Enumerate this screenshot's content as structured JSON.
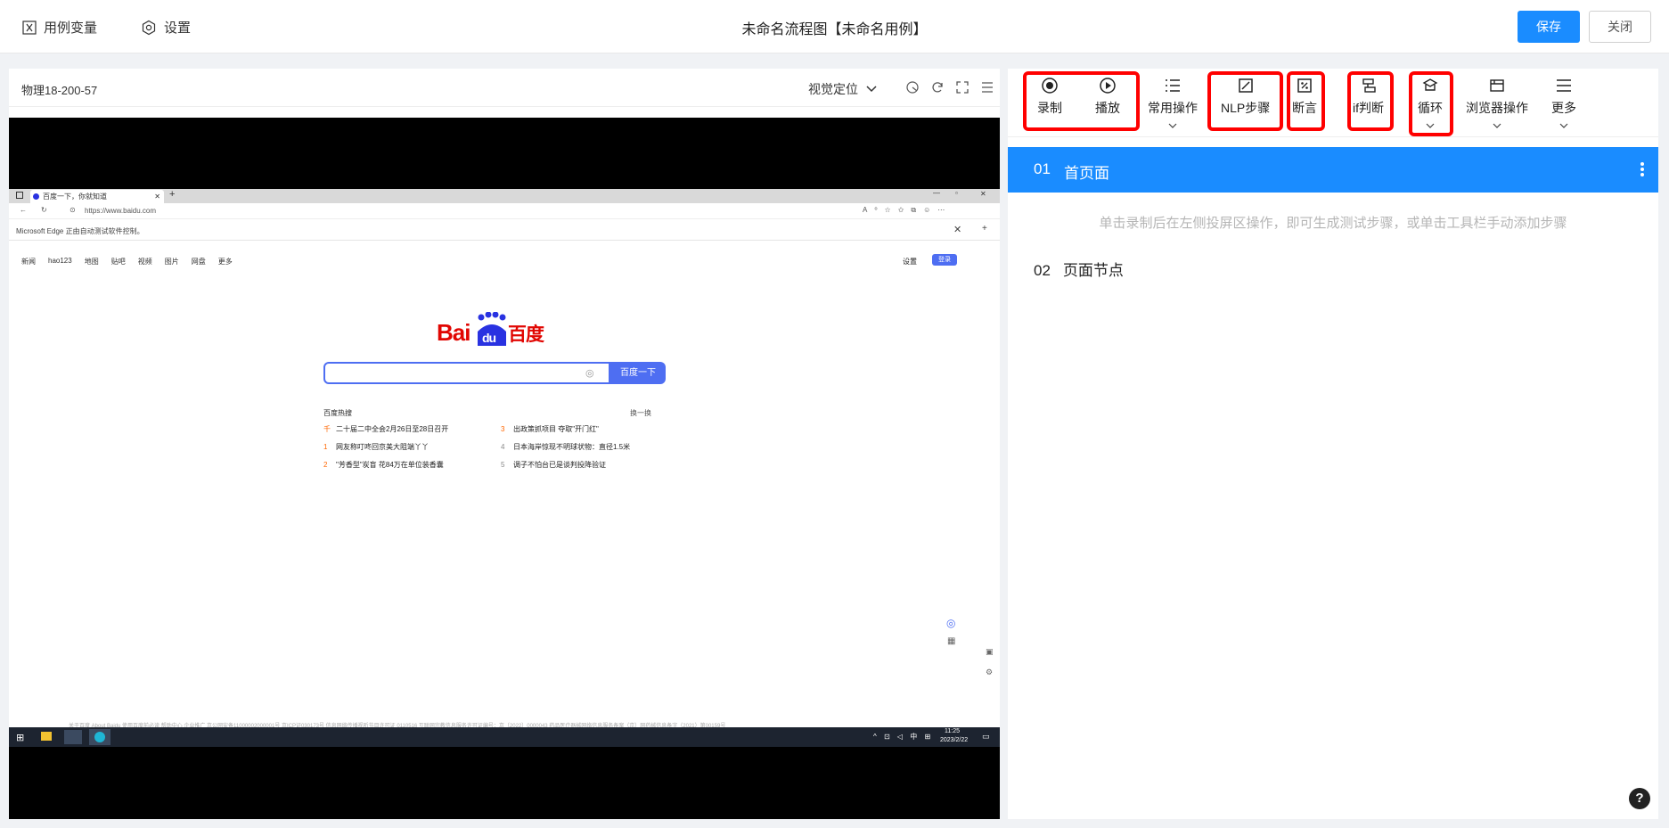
{
  "header": {
    "variables_label": "用例变量",
    "settings_label": "设置",
    "title": "未命名流程图【未命名用例】",
    "save_label": "保存",
    "close_label": "关闭"
  },
  "left_panel": {
    "device_name": "物理18-200-57",
    "visual_locate_label": "视觉定位"
  },
  "browser": {
    "tab_title": "百度一下，你就知道",
    "url": "https://www.baidu.com",
    "automation_notice": "Microsoft Edge 正由自动测试软件控制。",
    "nav_links": [
      "新闻",
      "hao123",
      "地图",
      "贴吧",
      "视频",
      "图片",
      "网盘",
      "更多"
    ],
    "settings_link": "设置",
    "login_button": "登录",
    "logo_text": "Bai度百度",
    "search_button": "百度一下",
    "hot_title": "百度热搜",
    "hot_refresh": "换一换",
    "hot_items": [
      {
        "num": "千",
        "text": "二十届二中全会2月26日至28日召开"
      },
      {
        "num": "1",
        "text": "网友称叮咚回京美大阻端丫丫"
      },
      {
        "num": "2",
        "text": "\"芳香型\"炭盲 花84万在单位装香囊"
      },
      {
        "num": "3",
        "text": "出政策抓项目 夺取\"开门红\""
      },
      {
        "num": "4",
        "text": "日本海岸惊现不明球状物：直径1.5米"
      },
      {
        "num": "5",
        "text": "调子不怕台已是谈判投降验证"
      }
    ],
    "footer_text": "关于百度   About Baidu   使用百度前必读   帮助中心   企业推广   京公网安备11000002000001号   京ICP证030173号   信息网络传播视听节目许可证 0110516   互联网宗教信息服务许可证编号：京（2022）0000043   药品医疗器械网络信息服务备案（京）网药械信息备字（2021）第00159号",
    "taskbar_time": "11:25",
    "taskbar_date": "2023/2/22"
  },
  "toolbar": {
    "items": [
      {
        "label": "录制",
        "icon": "record-icon"
      },
      {
        "label": "播放",
        "icon": "play-icon"
      },
      {
        "label": "常用操作",
        "icon": "list-icon"
      },
      {
        "label": "NLP步骤",
        "icon": "nlp-icon"
      },
      {
        "label": "断言",
        "icon": "assert-icon"
      },
      {
        "label": "if判断",
        "icon": "if-icon"
      },
      {
        "label": "循环",
        "icon": "loop-icon"
      },
      {
        "label": "浏览器操作",
        "icon": "browser-icon"
      },
      {
        "label": "更多",
        "icon": "menu-icon"
      }
    ]
  },
  "steps": {
    "step1_num": "01",
    "step1_label": "首页面",
    "hint": "单击录制后在左侧投屏区操作，即可生成测试步骤，或单击工具栏手动添加步骤",
    "step2_num": "02",
    "step2_label": "页面节点"
  },
  "colors": {
    "accent": "#1a8cff",
    "highlight": "#ff0000",
    "baidu_blue": "#4e6ef2"
  }
}
